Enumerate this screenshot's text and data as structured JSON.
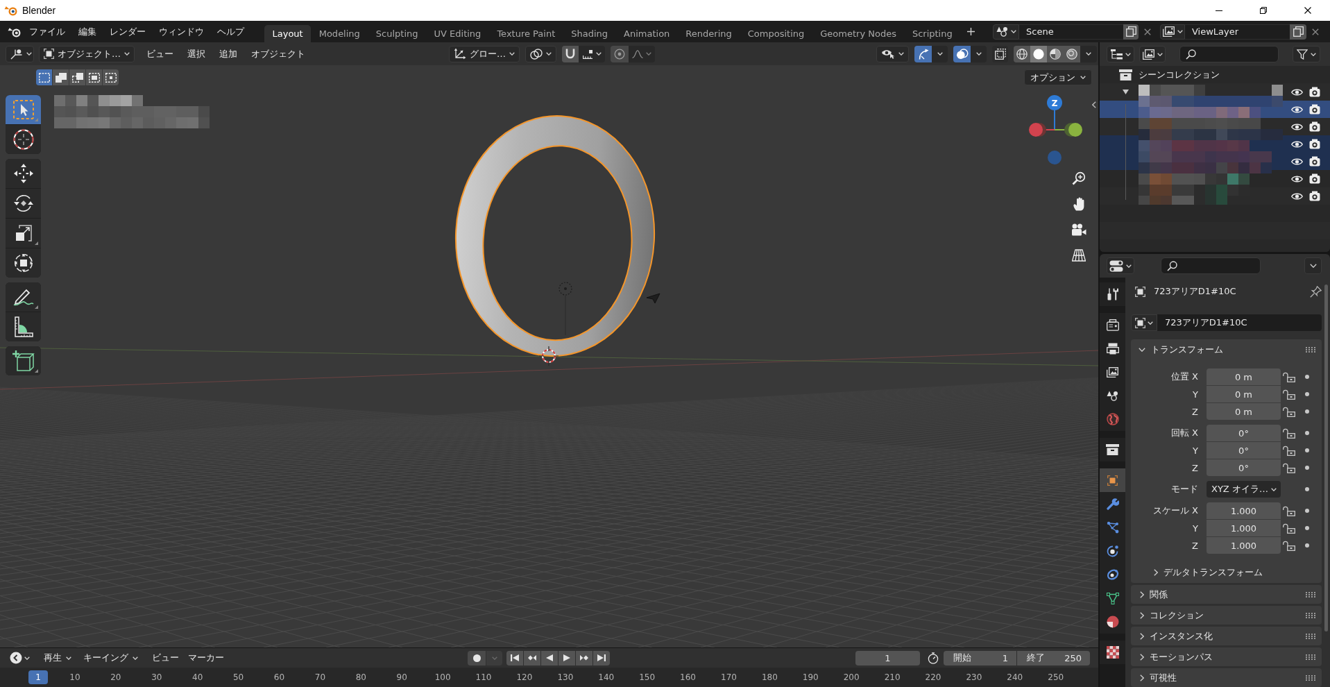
{
  "window": {
    "title": "Blender"
  },
  "topbar": {
    "menus": [
      "ファイル",
      "編集",
      "レンダー",
      "ウィンドウ",
      "ヘルプ"
    ],
    "workspaces": [
      {
        "label": "Layout",
        "selected": true
      },
      {
        "label": "Modeling",
        "selected": false
      },
      {
        "label": "Sculpting",
        "selected": false
      },
      {
        "label": "UV Editing",
        "selected": false
      },
      {
        "label": "Texture Paint",
        "selected": false
      },
      {
        "label": "Shading",
        "selected": false
      },
      {
        "label": "Animation",
        "selected": false
      },
      {
        "label": "Rendering",
        "selected": false
      },
      {
        "label": "Compositing",
        "selected": false
      },
      {
        "label": "Geometry Nodes",
        "selected": false
      },
      {
        "label": "Scripting",
        "selected": false
      }
    ],
    "scene": "Scene",
    "view_layer": "ViewLayer"
  },
  "viewport": {
    "header": {
      "mode": "オブジェクト…",
      "menus": [
        "ビュー",
        "選択",
        "追加",
        "オブジェクト"
      ],
      "orientation": "グロー…",
      "snapping_on": false,
      "proportional_on": false,
      "gizmos_on": true,
      "overlays_on": true,
      "xray_on": false,
      "shading": [
        {
          "kind": "wireframe",
          "selected": false
        },
        {
          "kind": "solid",
          "selected": true
        },
        {
          "kind": "material",
          "selected": false
        },
        {
          "kind": "rendered",
          "selected": false
        }
      ]
    },
    "select_modes": [
      {
        "kind": "new",
        "selected": true
      },
      {
        "kind": "extend",
        "selected": false
      },
      {
        "kind": "subtract",
        "selected": false
      },
      {
        "kind": "invert",
        "selected": false
      },
      {
        "kind": "intersect",
        "selected": false
      }
    ],
    "options": "オプション",
    "toolbar": [
      {
        "tools": [
          {
            "kind": "select_box",
            "selected": true
          },
          {
            "kind": "cursor",
            "selected": false
          }
        ]
      },
      {
        "tools": [
          {
            "kind": "move",
            "selected": false
          },
          {
            "kind": "rotate",
            "selected": false
          },
          {
            "kind": "scale",
            "selected": false
          },
          {
            "kind": "transform",
            "selected": false
          }
        ]
      },
      {
        "tools": [
          {
            "kind": "annotate",
            "selected": false
          },
          {
            "kind": "measure",
            "selected": false
          }
        ]
      },
      {
        "tools": [
          {
            "kind": "add_cube",
            "selected": false
          }
        ]
      }
    ],
    "nav_gizmo": {
      "label": "Z"
    }
  },
  "outliner": {
    "root": "シーンコレクション",
    "items": [
      {
        "expanded": true,
        "selected": false,
        "active": false,
        "visible": true,
        "renderable": true,
        "children": [
          {
            "selected": true,
            "active": true,
            "visible": true,
            "renderable": true
          },
          {
            "selected": false,
            "active": false,
            "visible": true,
            "renderable": true
          },
          {
            "selected": true,
            "active": false,
            "visible": true,
            "renderable": true
          },
          {
            "selected": true,
            "active": false,
            "visible": true,
            "renderable": true
          },
          {
            "selected": false,
            "active": false,
            "visible": true,
            "renderable": true
          },
          {
            "selected": false,
            "active": false,
            "visible": true,
            "renderable": true
          }
        ]
      }
    ]
  },
  "properties": {
    "tab_groups": [
      {
        "tabs": [
          {
            "kind": "tool",
            "selected": false
          }
        ]
      },
      {
        "tabs": [
          {
            "kind": "render",
            "selected": false
          },
          {
            "kind": "output",
            "selected": false
          },
          {
            "kind": "view_layer",
            "selected": false
          },
          {
            "kind": "scene",
            "selected": false
          },
          {
            "kind": "world",
            "selected": false
          }
        ]
      },
      {
        "tabs": [
          {
            "kind": "collection",
            "selected": false
          }
        ]
      },
      {
        "tabs": [
          {
            "kind": "object",
            "selected": true
          },
          {
            "kind": "modifiers",
            "selected": false
          },
          {
            "kind": "particles",
            "selected": false
          },
          {
            "kind": "physics",
            "selected": false
          },
          {
            "kind": "constraints",
            "selected": false
          },
          {
            "kind": "data",
            "selected": false
          },
          {
            "kind": "material",
            "selected": false
          }
        ]
      },
      {
        "tabs": [
          {
            "kind": "texture",
            "selected": false
          }
        ]
      }
    ],
    "object_name": "723アリアD1#10C",
    "name_field": "723アリアD1#10C",
    "panels": [
      {
        "title": "トランスフォーム",
        "expanded": true,
        "groups": [
          {
            "rows": [
              {
                "kind": "number",
                "label": "位置 X",
                "value": "0 m",
                "locked": false
              },
              {
                "kind": "number",
                "label": "Y",
                "value": "0 m",
                "locked": false
              },
              {
                "kind": "number",
                "label": "Z",
                "value": "0 m",
                "locked": false
              }
            ]
          },
          {
            "rows": [
              {
                "kind": "number",
                "label": "回転 X",
                "value": "0°",
                "locked": false
              },
              {
                "kind": "number",
                "label": "Y",
                "value": "0°",
                "locked": false
              },
              {
                "kind": "number",
                "label": "Z",
                "value": "0°",
                "locked": false
              }
            ]
          },
          {
            "rows": [
              {
                "kind": "dropdown",
                "label": "モード",
                "value": "XYZ オイラ…"
              }
            ]
          },
          {
            "rows": [
              {
                "kind": "number",
                "label": "スケール X",
                "value": "1.000",
                "locked": false
              },
              {
                "kind": "number",
                "label": "Y",
                "value": "1.000",
                "locked": false
              },
              {
                "kind": "number",
                "label": "Z",
                "value": "1.000",
                "locked": false
              }
            ]
          }
        ],
        "subpanels": [
          {
            "title": "デルタトランスフォーム",
            "expanded": false
          }
        ]
      },
      {
        "title": "関係",
        "expanded": false
      },
      {
        "title": "コレクション",
        "expanded": false
      },
      {
        "title": "インスタンス化",
        "expanded": false
      },
      {
        "title": "モーションパス",
        "expanded": false
      },
      {
        "title": "可視性",
        "expanded": false
      }
    ]
  },
  "timeline": {
    "menus": [
      {
        "kind": "dropdown",
        "label": "再生"
      },
      {
        "kind": "dropdown",
        "label": "キーイング"
      },
      {
        "kind": "menu",
        "label": "ビュー"
      },
      {
        "kind": "menu",
        "label": "マーカー"
      }
    ],
    "auto_keying_on": false,
    "current_frame": "1",
    "start_label": "開始",
    "start": "1",
    "end_label": "終了",
    "end": "250",
    "ruler": [
      {
        "label": "1",
        "selected": true
      },
      {
        "label": "10",
        "selected": false
      },
      {
        "label": "20",
        "selected": false
      },
      {
        "label": "30",
        "selected": false
      },
      {
        "label": "40",
        "selected": false
      },
      {
        "label": "50",
        "selected": false
      },
      {
        "label": "60",
        "selected": false
      },
      {
        "label": "70",
        "selected": false
      },
      {
        "label": "80",
        "selected": false
      },
      {
        "label": "90",
        "selected": false
      },
      {
        "label": "100",
        "selected": false
      },
      {
        "label": "110",
        "selected": false
      },
      {
        "label": "120",
        "selected": false
      },
      {
        "label": "130",
        "selected": false
      },
      {
        "label": "140",
        "selected": false
      },
      {
        "label": "150",
        "selected": false
      },
      {
        "label": "160",
        "selected": false
      },
      {
        "label": "170",
        "selected": false
      },
      {
        "label": "180",
        "selected": false
      },
      {
        "label": "190",
        "selected": false
      },
      {
        "label": "200",
        "selected": false
      },
      {
        "label": "210",
        "selected": false
      },
      {
        "label": "220",
        "selected": false
      },
      {
        "label": "230",
        "selected": false
      },
      {
        "label": "240",
        "selected": false
      },
      {
        "label": "250",
        "selected": false
      }
    ]
  }
}
